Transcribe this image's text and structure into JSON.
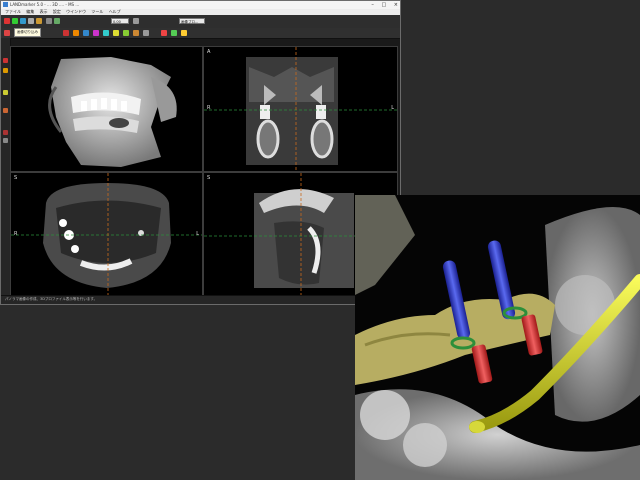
{
  "app": {
    "title": "LANDmarker 5.0 - ... 3D .... - MS ...",
    "menu": [
      "ファイル",
      "編集",
      "表示",
      "設定",
      "ウインドウ",
      "ツール",
      "ヘルプ"
    ],
    "tooltip": "画像切り込み",
    "zoom_field": "0.00",
    "window_field": "画像プロ...",
    "status": "パノラマ画像の作成、3Dプロファイル表示等を行います。"
  },
  "views": {
    "vol3d_corner": "",
    "axial_a": "A",
    "axial_r": "R",
    "axial_l": "L",
    "sagittal_a": "S",
    "coronal_r": "R",
    "coronal_l": "L",
    "sagittal_s": "S"
  },
  "colors": {
    "implant_blue": "#2f3fd0",
    "abutment_red": "#e03a3a",
    "nerve_yellow": "#e8ea2a",
    "bone_tan": "#b7ad62",
    "crosshair_orange": "#c86a1c",
    "crosshair_green": "#2d8f3a"
  }
}
